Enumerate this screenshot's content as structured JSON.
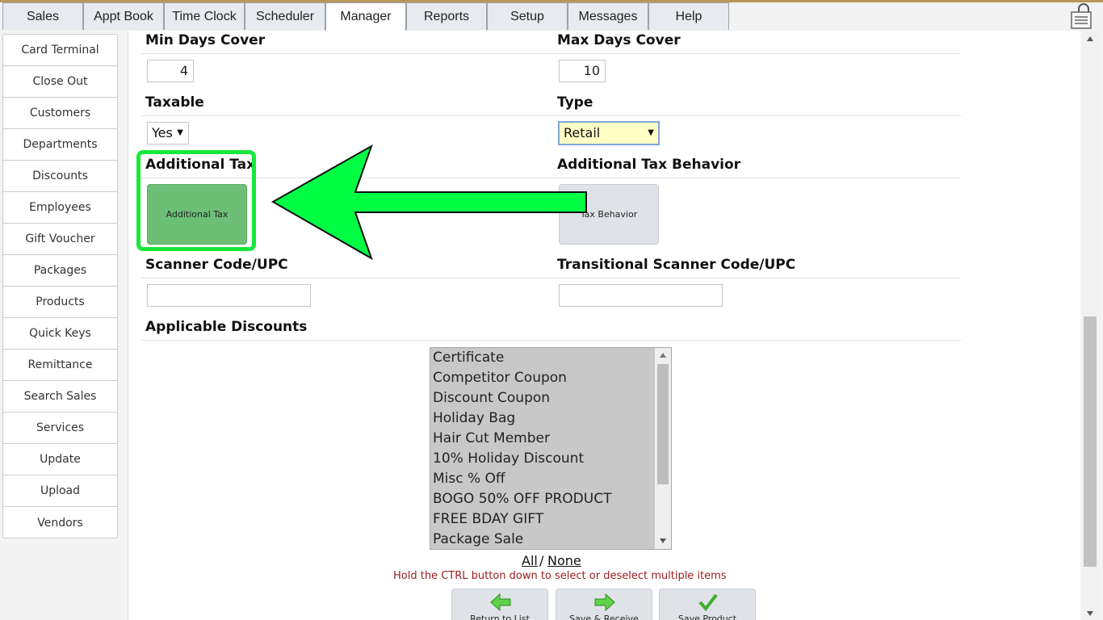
{
  "tabs": [
    "Sales",
    "Appt Book",
    "Time Clock",
    "Scheduler",
    "Manager",
    "Reports",
    "Setup",
    "Messages",
    "Help"
  ],
  "active_tab": "Manager",
  "sidebar": {
    "items": [
      "Card Terminal",
      "Close Out",
      "Customers",
      "Departments",
      "Discounts",
      "Employees",
      "Gift Voucher",
      "Packages",
      "Products",
      "Quick Keys",
      "Remittance",
      "Search Sales",
      "Services",
      "Update",
      "Upload",
      "Vendors"
    ]
  },
  "form": {
    "min_days_cover": {
      "label": "Min Days Cover",
      "value": "4"
    },
    "max_days_cover": {
      "label": "Max Days Cover",
      "value": "10"
    },
    "taxable": {
      "label": "Taxable",
      "value": "Yes"
    },
    "type": {
      "label": "Type",
      "value": "Retail"
    },
    "additional_tax": {
      "label": "Additional Tax",
      "button": "Additional Tax"
    },
    "additional_tax_behavior": {
      "label": "Additional Tax Behavior",
      "button": "Tax Behavior"
    },
    "scanner_code": {
      "label": "Scanner Code/UPC",
      "value": ""
    },
    "transitional_scanner_code": {
      "label": "Transitional Scanner Code/UPC",
      "value": ""
    },
    "applicable_discounts": {
      "label": "Applicable Discounts",
      "options": [
        "Certificate",
        "Competitor Coupon",
        "Discount Coupon",
        "Holiday Bag",
        "Hair Cut Member",
        "10% Holiday Discount",
        "Misc % Off",
        "BOGO 50% OFF PRODUCT",
        "FREE BDAY GIFT",
        "Package Sale"
      ],
      "all_link": "All",
      "separator": "/",
      "none_link": "None",
      "hint": "Hold the CTRL button down to select or deselect multiple items"
    }
  },
  "actions": {
    "return": "Return to List",
    "save_receive": "Save & Receive",
    "save_product": "Save Product"
  },
  "colors": {
    "highlight": "#17e83a",
    "type_select_bg": "#ffffc6",
    "additional_tax_btn": "#6dbf78",
    "hint_text": "#9b1c1c"
  }
}
